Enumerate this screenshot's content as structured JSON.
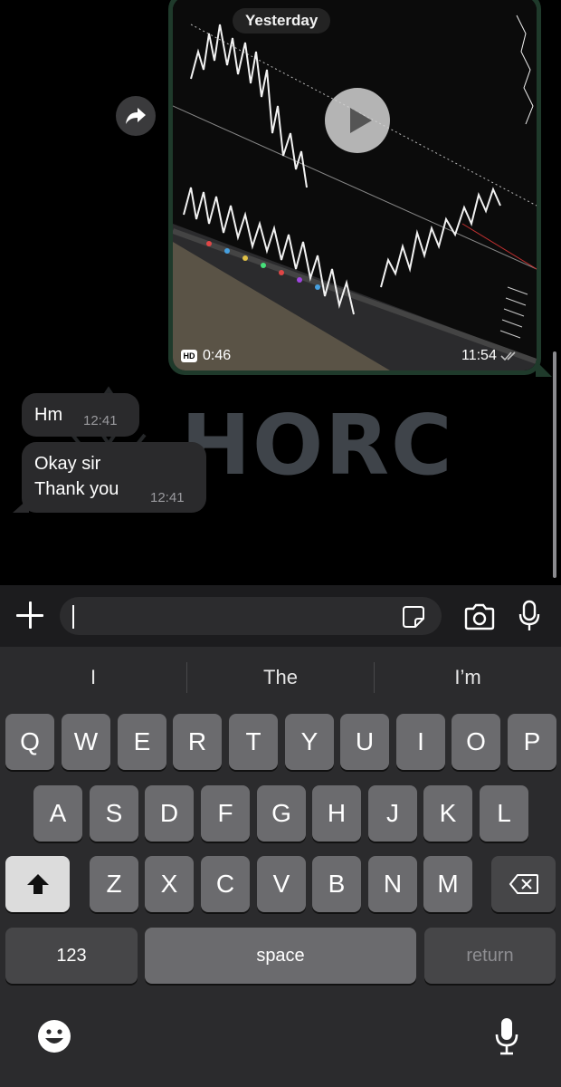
{
  "chat": {
    "date_label": "Yesterday",
    "wallpaper_text": "HORC",
    "video_message": {
      "hd_label": "HD",
      "duration": "0:46",
      "time": "11:54",
      "play_icon": "play-icon",
      "status_icon": "double-check-icon"
    },
    "messages": [
      {
        "text": "Hm",
        "time": "12:41"
      },
      {
        "text_line1": "Okay sir",
        "text_line2": "Thank you",
        "time": "12:41"
      }
    ],
    "forward_icon": "forward-icon"
  },
  "input_bar": {
    "value": "",
    "placeholder": "",
    "icons": [
      "plus-icon",
      "sticker-icon",
      "camera-icon",
      "microphone-icon"
    ]
  },
  "keyboard": {
    "suggestions": [
      "I",
      "The",
      "I’m"
    ],
    "row1": [
      "Q",
      "W",
      "E",
      "R",
      "T",
      "Y",
      "U",
      "I",
      "O",
      "P"
    ],
    "row2": [
      "A",
      "S",
      "D",
      "F",
      "G",
      "H",
      "J",
      "K",
      "L"
    ],
    "row3": [
      "Z",
      "X",
      "C",
      "V",
      "B",
      "N",
      "M"
    ],
    "numbers_label": "123",
    "space_label": "space",
    "return_label": "return",
    "icons": [
      "shift-icon",
      "backspace-icon",
      "emoji-icon",
      "dictation-icon"
    ]
  },
  "colors": {
    "video_bubble_border": "#1f3a2b",
    "incoming_bubble": "#2a2a2c",
    "keyboard_bg": "#2b2b2d",
    "key_bg": "#6b6b6e"
  }
}
